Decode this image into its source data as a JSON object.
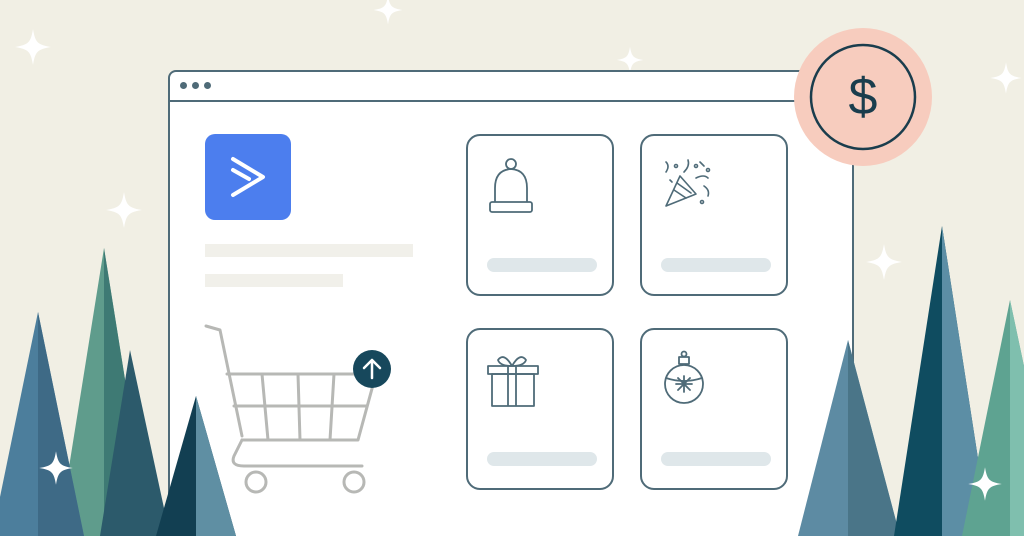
{
  "scene": {
    "background_color": "#f1efe4",
    "accent_blue": "#4c7eee",
    "outline_color": "#4f6b78",
    "dark_teal": "#17485c",
    "coin_pink": "#f7ccbe"
  },
  "browser": {
    "window_dots": 3,
    "logo_icon": "chevron-right-logo-icon",
    "cart_icon": "shopping-cart-icon",
    "upload_icon": "arrow-up-icon"
  },
  "product_cards": [
    {
      "icon": "winter-hat-icon"
    },
    {
      "icon": "party-popper-icon"
    },
    {
      "icon": "gift-box-icon"
    },
    {
      "icon": "ornament-icon"
    }
  ],
  "coin": {
    "symbol": "$"
  }
}
